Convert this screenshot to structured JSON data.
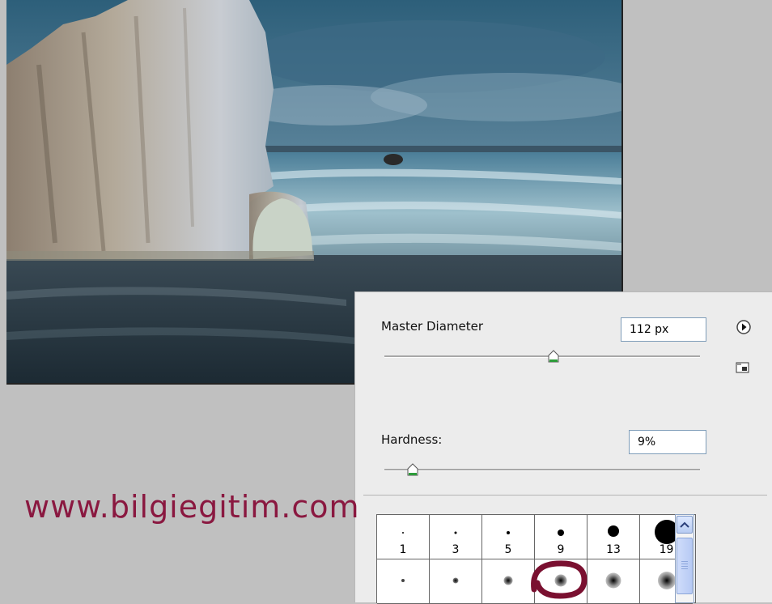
{
  "brush_panel": {
    "master_diameter_label": "Master Diameter",
    "master_diameter_value": "112 px",
    "master_diameter_slider_fraction": 0.53,
    "hardness_label": "Hardness:",
    "hardness_value": "9%",
    "hardness_slider_fraction": 0.09,
    "presets_row1": [
      "1",
      "3",
      "5",
      "9",
      "13",
      "19"
    ]
  },
  "watermark": "www.bilgiegitim.com",
  "icons": {
    "flyout_menu": "play-circle-icon",
    "new_preset": "new-preset-icon",
    "scroll_up": "chevron-up-icon"
  },
  "colors": {
    "panel_bg": "#ececec",
    "watermark": "#8a1840",
    "highlight": "#7a1030"
  }
}
